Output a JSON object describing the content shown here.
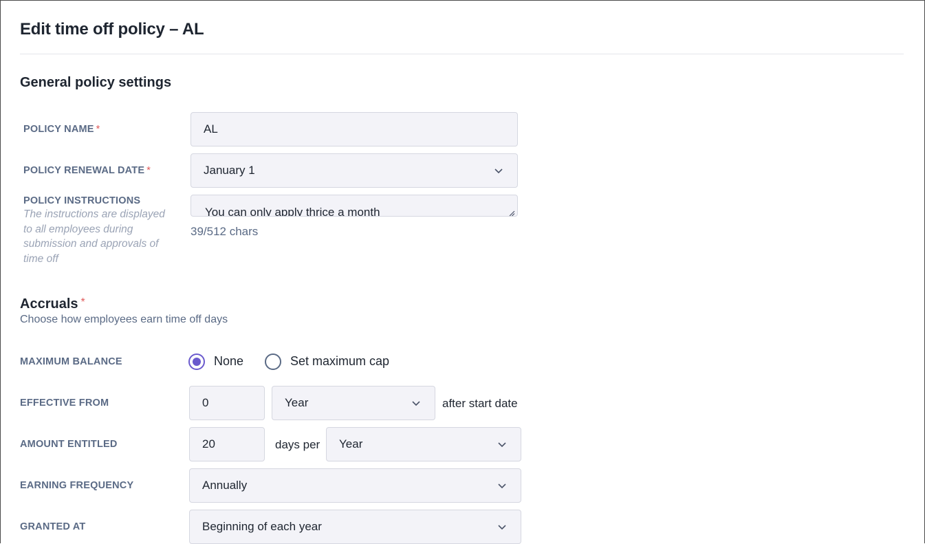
{
  "page": {
    "title": "Edit time off policy – AL"
  },
  "general": {
    "heading": "General policy settings",
    "policy_name": {
      "label": "POLICY NAME",
      "required": "*",
      "value": "AL"
    },
    "renewal_date": {
      "label": "POLICY RENEWAL DATE",
      "required": "*",
      "value": "January 1"
    },
    "instructions": {
      "label": "POLICY INSTRUCTIONS",
      "help": "The instructions are displayed to all employees during submission and approvals of time off",
      "value": "You can only apply thrice a month",
      "counter": "39/512 chars"
    }
  },
  "accruals": {
    "heading": "Accruals",
    "required": "*",
    "subtitle": "Choose how employees earn time off days",
    "maximum_balance": {
      "label": "MAXIMUM BALANCE",
      "options": [
        {
          "label": "None",
          "checked": true
        },
        {
          "label": "Set maximum cap",
          "checked": false
        }
      ]
    },
    "effective_from": {
      "label": "EFFECTIVE FROM",
      "amount": "0",
      "unit": "Year",
      "suffix": "after start date"
    },
    "amount_entitled": {
      "label": "AMOUNT ENTITLED",
      "amount": "20",
      "connector": "days per",
      "unit": "Year"
    },
    "earning_frequency": {
      "label": "EARNING FREQUENCY",
      "value": "Annually"
    },
    "granted_at": {
      "label": "GRANTED AT",
      "value": "Beginning of each year"
    }
  },
  "colors": {
    "accent": "#6a5acd",
    "required": "#e05a5a",
    "label": "#5a6a85",
    "field_bg": "#f3f3f8"
  },
  "icons": {
    "select": "chevron-down-icon",
    "textarea": "resize-handle-icon"
  }
}
